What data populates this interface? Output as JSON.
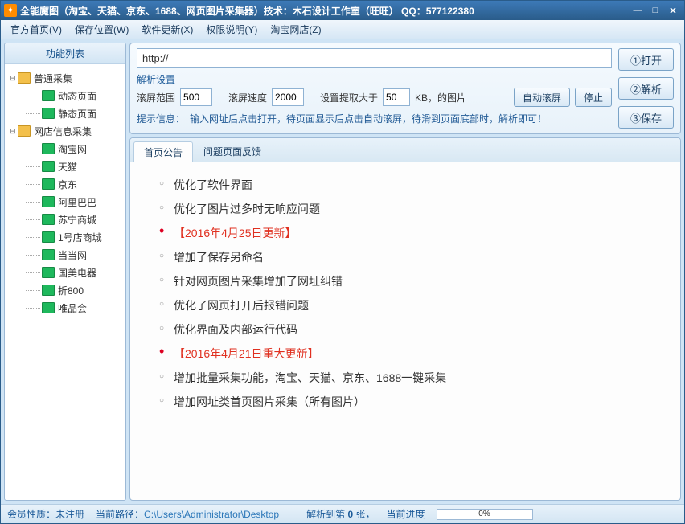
{
  "title": "全能魔图（淘宝、天猫、京东、1688、网页图片采集器）技术：木石设计工作室（旺旺）  QQ：577122380",
  "menus": [
    "官方首页(V)",
    "保存位置(W)",
    "软件更新(X)",
    "权限说明(Y)",
    "淘宝网店(Z)"
  ],
  "sidebar": {
    "title": "功能列表",
    "groups": [
      {
        "label": "普通采集",
        "children": [
          "动态页面",
          "静态页面"
        ]
      },
      {
        "label": "网店信息采集",
        "children": [
          "淘宝网",
          "天猫",
          "京东",
          "阿里巴巴",
          "苏宁商城",
          "1号店商城",
          "当当网",
          "国美电器",
          "折800",
          "唯品会"
        ]
      }
    ]
  },
  "url": {
    "value": "http://",
    "open": "①打开"
  },
  "parse": {
    "section": "解析设置",
    "scroll_range_label": "滚屏范围",
    "scroll_range": "500",
    "scroll_speed_label": "滚屏速度",
    "scroll_speed": "2000",
    "extract_label_prefix": "设置提取大于",
    "extract_kb": "50",
    "extract_label_suffix": "KB，的图片",
    "auto_scroll": "自动滚屏",
    "stop": "停止",
    "parse_btn": "②解析",
    "save_btn": "③保存"
  },
  "hint": {
    "label": "提示信息：",
    "text": "输入网址后点击打开，待页面显示后点击自动滚屏，待滑到页面底部时，解析即可！"
  },
  "tabs": {
    "t1": "首页公告",
    "t2": "问题页面反馈"
  },
  "bulletins": [
    {
      "red": false,
      "text": "优化了软件界面"
    },
    {
      "red": false,
      "text": "优化了图片过多时无响应问题"
    },
    {
      "red": true,
      "text": "【2016年4月25日更新】"
    },
    {
      "red": false,
      "text": "增加了保存另命名"
    },
    {
      "red": false,
      "text": "针对网页图片采集增加了网址纠错"
    },
    {
      "red": false,
      "text": "优化了网页打开后报错问题"
    },
    {
      "red": false,
      "text": "优化界面及内部运行代码"
    },
    {
      "red": true,
      "text": "【2016年4月21日重大更新】"
    },
    {
      "red": false,
      "text": "增加批量采集功能，淘宝、天猫、京东、1688一键采集"
    },
    {
      "red": false,
      "text": "增加网址类首页图片采集（所有图片）"
    }
  ],
  "status": {
    "member_label": "会员性质：",
    "member_value": "未注册",
    "path_label": "当前路径：",
    "path_value": "C:\\Users\\Administrator\\Desktop",
    "parsed_label": "解析到第",
    "parsed_count": "0",
    "parsed_suffix": "张，",
    "progress_label": "当前进度",
    "progress_text": "0%"
  }
}
